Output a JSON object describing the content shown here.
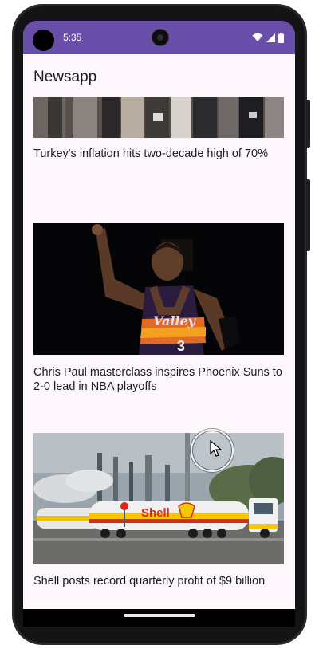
{
  "status_bar": {
    "time": "5:35"
  },
  "app_bar": {
    "title": "Newsapp"
  },
  "articles": [
    {
      "headline": "Turkey's inflation hits two-decade high of 70%"
    },
    {
      "headline": "Chris Paul masterclass inspires Phoenix Suns to 2-0 lead in NBA playoffs",
      "jersey_text": "Valley",
      "jersey_number": "3"
    },
    {
      "headline": "Shell posts record quarterly profit of $9 billion",
      "truck_logo": "Shell"
    }
  ],
  "colors": {
    "status_bar": "#6a4faa",
    "background": "#fdf7fb",
    "text": "#1c1b1f"
  }
}
